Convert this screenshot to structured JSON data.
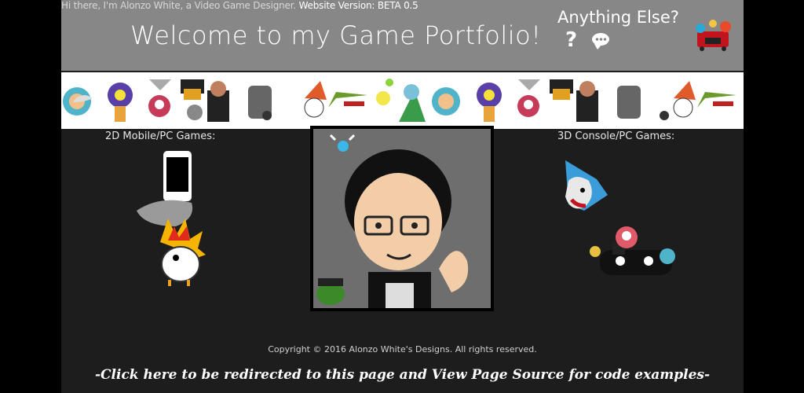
{
  "header": {
    "intro": "Hi there, I'm Alonzo White, a Video Game Designer.",
    "version": "Website Version: BETA 0.5",
    "title": "Welcome to my Game Portfolio!",
    "anything_else": "Anything Else?",
    "question_icon": "question-mark-icon",
    "chat_icon": "chat-bubble-icon"
  },
  "sections": {
    "left_label": "2D Mobile/PC Games:",
    "right_label": "3D Console/PC Games:"
  },
  "footer": {
    "copyright": "Copyright © 2016 Alonzo White's Designs. All rights reserved.",
    "redirect": "-Click here to be redirected to this page and View Page Source for code examples-"
  },
  "colors": {
    "header_bg": "#878787",
    "page_bg": "#1d1d1d",
    "outer_bg": "#000000"
  }
}
